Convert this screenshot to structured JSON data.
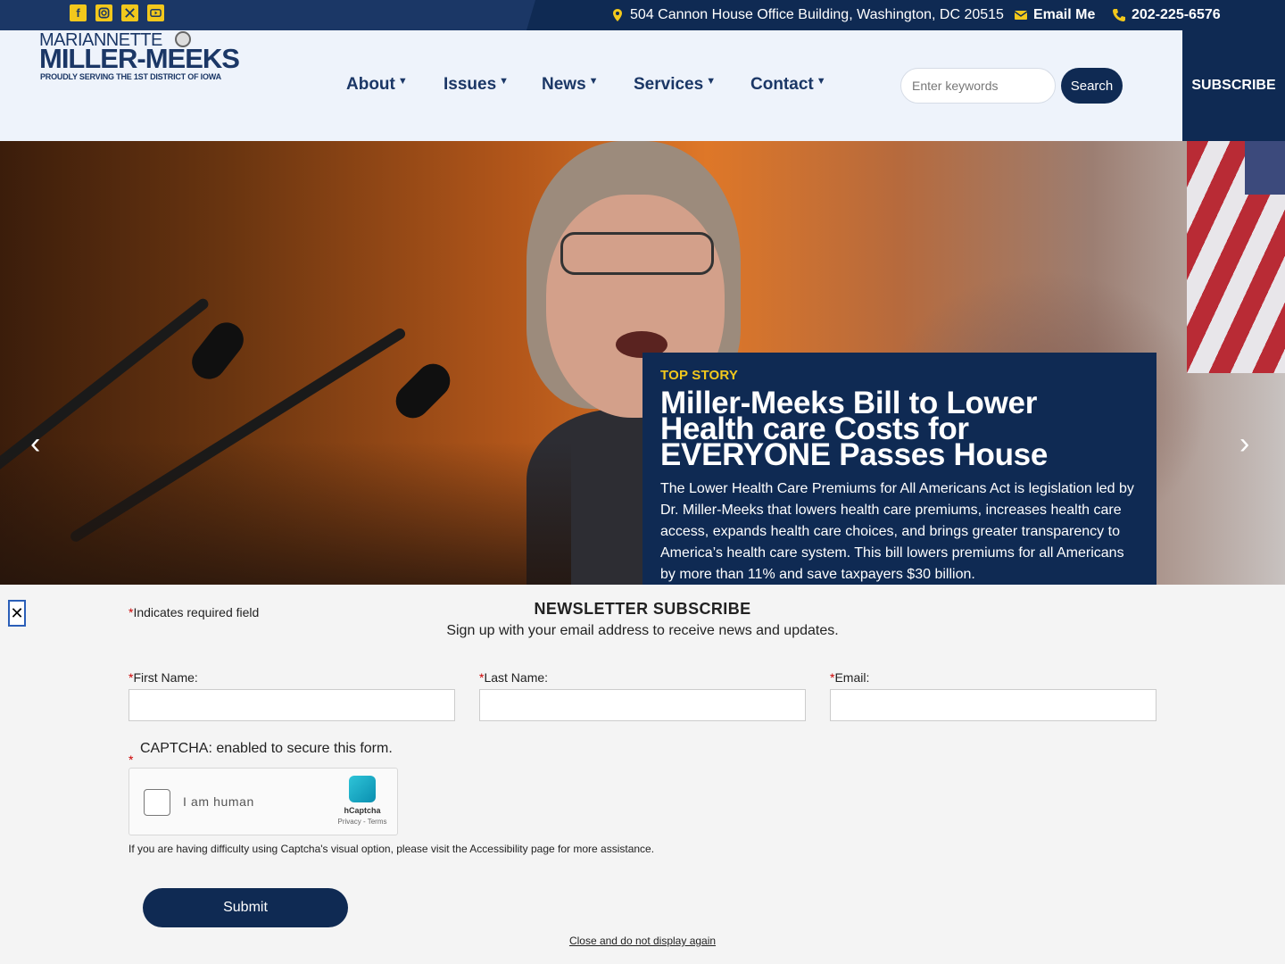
{
  "topbar": {
    "social": [
      {
        "icon": "facebook-icon",
        "glyph": "f"
      },
      {
        "icon": "instagram-icon",
        "glyph": ""
      },
      {
        "icon": "x-twitter-icon",
        "glyph": "𝕏"
      },
      {
        "icon": "youtube-icon",
        "glyph": ""
      }
    ],
    "address": "504 Cannon House Office Building, Washington, DC 20515",
    "email_label": "Email Me",
    "phone": "202-225-6576"
  },
  "logo": {
    "first_name": "MARIANNETTE",
    "last_name": "MILLER-MEEKS",
    "tagline": "PROUDLY SERVING THE 1ST DISTRICT OF IOWA"
  },
  "nav": {
    "about": "About",
    "issues": "Issues",
    "news": "News",
    "services": "Services",
    "contact": "Contact",
    "caret": "▼"
  },
  "search": {
    "placeholder": "Enter keywords",
    "button": "Search"
  },
  "subscribe_label": "SUBSCRIBE",
  "hero": {
    "prev": "‹",
    "next": "›",
    "kicker": "TOP STORY",
    "title": "Miller-Meeks Bill to Lower Health care Costs for EVERYONE Passes House",
    "body": "The Lower Health Care Premiums for All Americans Act is legislation led by Dr. Miller-Meeks that lowers health care premiums, increases health care access, expands health care choices, and brings greater transparency to America’s health care system. This bill lowers premiums for all Americans by more than 11% and save taxpayers $30 billion."
  },
  "newsletter": {
    "close_glyph": "✕",
    "required_star": "*",
    "required_note": "Indicates required field",
    "title": "NEWSLETTER SUBSCRIBE",
    "subtitle": "Sign up with your email address to receive news and updates.",
    "first_name_label": "First Name:",
    "last_name_label": "Last Name:",
    "email_label": "Email:",
    "first_name_value": "",
    "last_name_value": "",
    "email_value": "",
    "captcha_label": "CAPTCHA: enabled to secure this form.",
    "captcha_text": "I am human",
    "captcha_brand": "hCaptcha",
    "captcha_links": "Privacy - Terms",
    "captcha_help": "If you are having difficulty using Captcha's visual option, please visit the Accessibility page for more assistance.",
    "submit": "Submit",
    "close_link": "Close and do not display again"
  },
  "colors": {
    "navy": "#0f2a53",
    "topbar": "#1b3766",
    "accent_yellow": "#f2c81c",
    "required_red": "#cc0000"
  }
}
